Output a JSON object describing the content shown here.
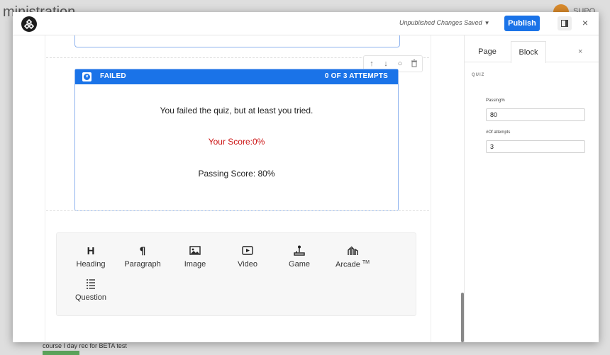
{
  "background": {
    "title": "ministration",
    "user": "SUPO",
    "bottom_text": "course I day rec for BETA test",
    "tag_text": ""
  },
  "topbar": {
    "status_text": "Unpublished Changes Saved",
    "publish_label": "Publish",
    "close_glyph": "×"
  },
  "block_tools": {
    "up": "↑",
    "down": "↓",
    "duplicate": "○",
    "delete": "🗑"
  },
  "quiz": {
    "status_label": "FAILED",
    "attempts": "0 OF 3 ATTEMPTS",
    "message": "You failed the quiz, but at least you tried.",
    "your_score": "Your Score:0%",
    "passing_score": "Passing Score: 80%"
  },
  "palette": {
    "items": [
      {
        "label": "Heading",
        "icon": "heading-icon"
      },
      {
        "label": "Paragraph",
        "icon": "paragraph-icon"
      },
      {
        "label": "Image",
        "icon": "image-icon"
      },
      {
        "label": "Video",
        "icon": "video-icon"
      },
      {
        "label": "Game",
        "icon": "joystick-icon"
      },
      {
        "label": "Arcade",
        "icon": "arcade-icon"
      },
      {
        "label": "Question",
        "icon": "list-icon"
      }
    ],
    "arcade_tm": "TM"
  },
  "sidebar": {
    "tabs": [
      {
        "label": "Page"
      },
      {
        "label": "Block"
      }
    ],
    "close_glyph": "×",
    "section_title": "QUIZ",
    "passing_label": "Passing%",
    "passing_value": "80",
    "attempts_label": "#Of attempts",
    "attempts_value": "3"
  },
  "colors": {
    "accent": "#1a73e8",
    "fail_score": "#cc1414"
  }
}
